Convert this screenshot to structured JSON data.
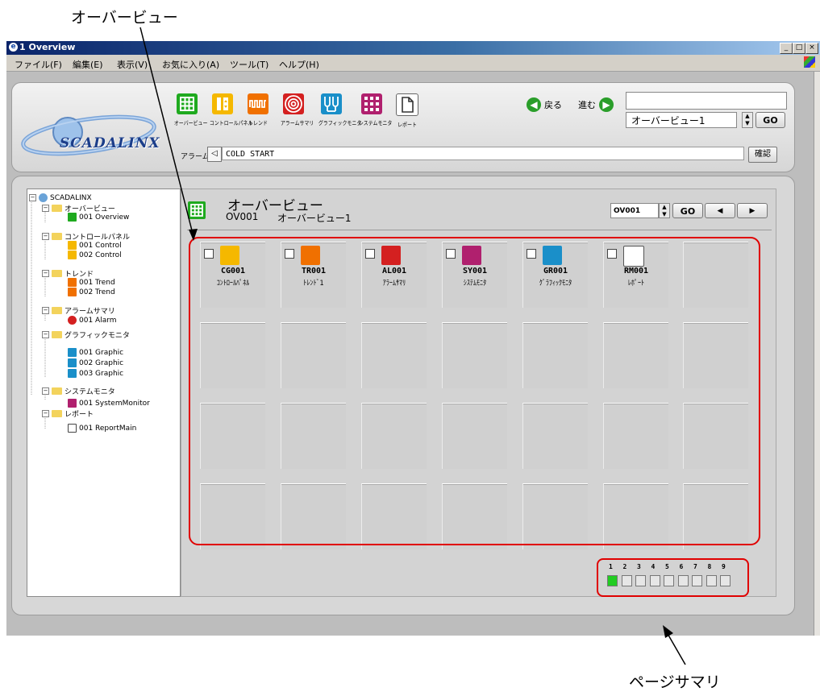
{
  "callouts": {
    "overview": "オーバービュー",
    "page_summary": "ページサマリ"
  },
  "window": {
    "title": "1 Overview",
    "controls": [
      "_",
      "□",
      "×"
    ]
  },
  "menu": [
    "ファイル(F)",
    "編集(E)",
    "表示(V)",
    "お気に入り(A)",
    "ツール(T)",
    "ヘルプ(H)"
  ],
  "logo_text": "SCADALINX",
  "toolbar": [
    {
      "label": "オーバービュー",
      "icon": "grid-icon",
      "color": "#1faa1f"
    },
    {
      "label": "コントロールパネル",
      "icon": "control-panel-icon",
      "color": "#f5b800"
    },
    {
      "label": "トレンド",
      "icon": "trend-icon",
      "color": "#f07000"
    },
    {
      "label": "アラームサマリ",
      "icon": "alarm-icon",
      "color": "#d42020"
    },
    {
      "label": "グラフィックモニタ",
      "icon": "graphic-monitor-icon",
      "color": "#1a8fc9"
    },
    {
      "label": "システムモニタ",
      "icon": "system-monitor-icon",
      "color": "#b0206e"
    },
    {
      "label": "レポート",
      "icon": "report-icon",
      "color": "#ffffff"
    }
  ],
  "nav": {
    "back": "戻る",
    "forward": "進む"
  },
  "selector": {
    "value": "オーバービュー1",
    "go": "GO"
  },
  "alarm": {
    "label": "アラーム",
    "message": "COLD START",
    "confirm": "確認"
  },
  "tree": [
    {
      "text": "SCADALINX",
      "level": 0,
      "kind": "root"
    },
    {
      "text": "オーバービュー",
      "level": 1,
      "kind": "folder"
    },
    {
      "text": "001 Overview",
      "level": 2,
      "kind": "overview"
    },
    {
      "text": "コントロールパネル",
      "level": 1,
      "kind": "folder"
    },
    {
      "text": "001 Control",
      "level": 2,
      "kind": "control"
    },
    {
      "text": "002 Control",
      "level": 2,
      "kind": "control"
    },
    {
      "text": "トレンド",
      "level": 1,
      "kind": "folder"
    },
    {
      "text": "001 Trend",
      "level": 2,
      "kind": "trend"
    },
    {
      "text": "002 Trend",
      "level": 2,
      "kind": "trend"
    },
    {
      "text": "アラームサマリ",
      "level": 1,
      "kind": "folder"
    },
    {
      "text": "001 Alarm",
      "level": 2,
      "kind": "alarm"
    },
    {
      "text": "グラフィックモニタ",
      "level": 1,
      "kind": "folder"
    },
    {
      "text": "001 Graphic",
      "level": 2,
      "kind": "graphic"
    },
    {
      "text": "002 Graphic",
      "level": 2,
      "kind": "graphic"
    },
    {
      "text": "003 Graphic",
      "level": 2,
      "kind": "graphic"
    },
    {
      "text": "システムモニタ",
      "level": 1,
      "kind": "folder"
    },
    {
      "text": "001 SystemMonitor",
      "level": 2,
      "kind": "system"
    },
    {
      "text": "レポート",
      "level": 1,
      "kind": "folder"
    },
    {
      "text": "001 ReportMain",
      "level": 2,
      "kind": "report"
    }
  ],
  "header": {
    "title": "オーバービュー",
    "code": "OV001",
    "name": "オーバービュー1",
    "selector": "OV001",
    "go": "GO",
    "prev": "◀",
    "next": "▶"
  },
  "tiles": [
    {
      "code": "CG001",
      "name": "ｺﾝﾄﾛｰﾙﾊﾟﾈﾙ",
      "icon": "control-panel-icon",
      "color": "#f5b800"
    },
    {
      "code": "TR001",
      "name": "ﾄﾚﾝﾄﾞ1",
      "icon": "trend-icon",
      "color": "#f07000"
    },
    {
      "code": "AL001",
      "name": "ｱﾗｰﾑｻﾏﾘ",
      "icon": "alarm-icon",
      "color": "#d42020"
    },
    {
      "code": "SY001",
      "name": "ｼｽﾃﾑﾓﾆﾀ",
      "icon": "system-monitor-icon",
      "color": "#b0206e"
    },
    {
      "code": "GR001",
      "name": "ｸﾞﾗﾌｨｯｸﾓﾆﾀ",
      "icon": "graphic-monitor-icon",
      "color": "#1a8fc9"
    },
    {
      "code": "RM001",
      "name": "ﾚﾎﾟｰﾄ",
      "icon": "report-icon",
      "color": "#ffffff"
    }
  ],
  "pages": {
    "numbers": [
      "1",
      "2",
      "3",
      "4",
      "5",
      "6",
      "7",
      "8",
      "9"
    ],
    "active": 1,
    "active_color": "#22cc22"
  },
  "highlight_color": "#e00000"
}
